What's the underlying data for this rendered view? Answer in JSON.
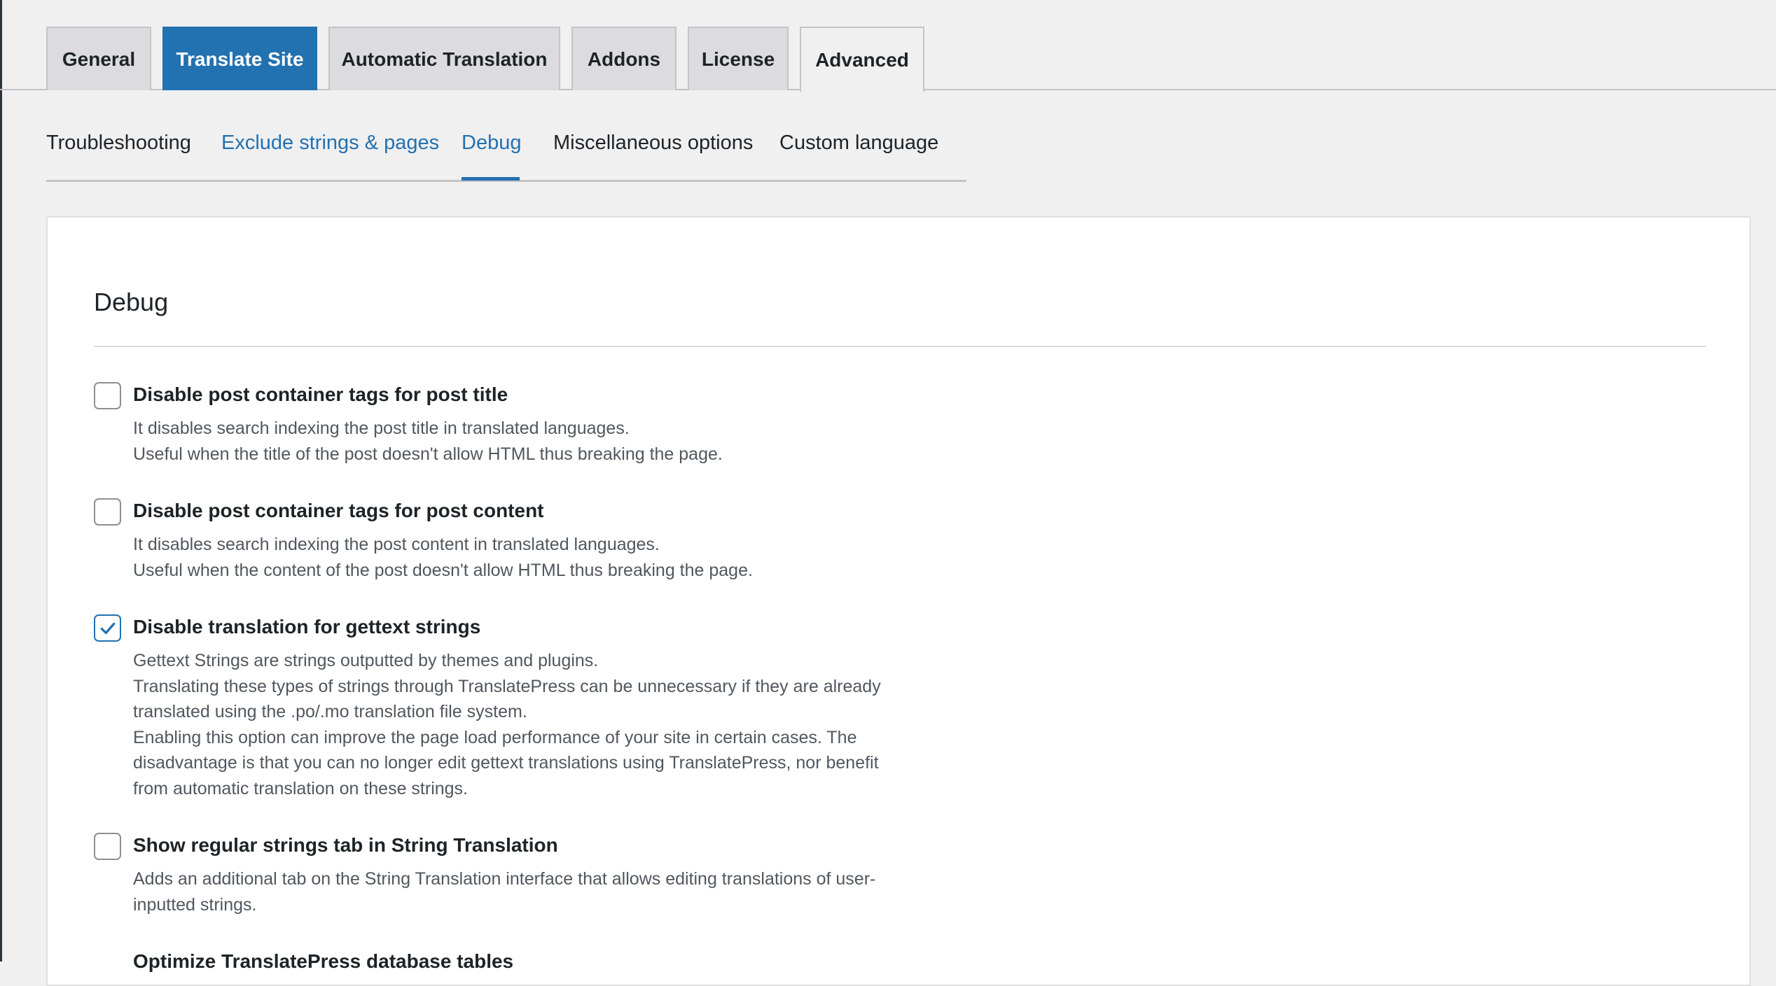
{
  "tabs": [
    {
      "label": "General"
    },
    {
      "label": "Translate Site"
    },
    {
      "label": "Automatic Translation"
    },
    {
      "label": "Addons"
    },
    {
      "label": "License"
    },
    {
      "label": "Advanced"
    }
  ],
  "subnav": [
    {
      "label": "Troubleshooting"
    },
    {
      "label": "Exclude strings & pages"
    },
    {
      "label": "Debug"
    },
    {
      "label": "Miscellaneous options"
    },
    {
      "label": "Custom language"
    }
  ],
  "panel": {
    "title": "Debug",
    "options": [
      {
        "label": "Disable post container tags for post title",
        "checked": false,
        "desc": [
          "It disables search indexing the post title in translated languages.",
          "Useful when the title of the post doesn't allow HTML thus breaking the page."
        ]
      },
      {
        "label": "Disable post container tags for post content",
        "checked": false,
        "desc": [
          "It disables search indexing the post content in translated languages.",
          "Useful when the content of the post doesn't allow HTML thus breaking the page."
        ]
      },
      {
        "label": "Disable translation for gettext strings",
        "checked": true,
        "desc": [
          "Gettext Strings are strings outputted by themes and plugins.",
          "Translating these types of strings through TranslatePress can be unnecessary if they are already",
          "translated using the .po/.mo translation file system.",
          "Enabling this option can improve the page load performance of your site in certain cases. The",
          "disadvantage is that you can no longer edit gettext translations using TranslatePress, nor benefit",
          "from automatic translation on these strings."
        ]
      },
      {
        "label": "Show regular strings tab in String Translation",
        "checked": false,
        "desc": [
          "Adds an additional tab on the String Translation interface that allows editing translations of user-",
          "inputted strings."
        ]
      },
      {
        "label": "Optimize TranslatePress database tables",
        "checked": false,
        "desc": []
      }
    ]
  },
  "colors": {
    "accent": "#2271b1",
    "background": "#f0f0f1",
    "panel": "#ffffff"
  }
}
